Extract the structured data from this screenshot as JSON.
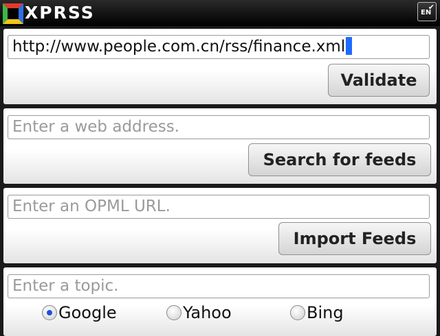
{
  "app": {
    "title": "XPRSS",
    "lang_button": "EN"
  },
  "validate_section": {
    "url_value": "http://www.people.com.cn/rss/finance.xml",
    "button_label": "Validate"
  },
  "search_section": {
    "placeholder": "Enter a web address.",
    "button_label": "Search for feeds"
  },
  "opml_section": {
    "placeholder": "Enter an OPML URL.",
    "button_label": "Import Feeds"
  },
  "topic_section": {
    "placeholder": "Enter a topic.",
    "engines": [
      {
        "label": "Google",
        "selected": true
      },
      {
        "label": "Yahoo",
        "selected": false
      },
      {
        "label": "Bing",
        "selected": false
      }
    ]
  },
  "colors": {
    "accent": "#1e6bff",
    "background": "#1a1a1a"
  },
  "icons": [
    "xprss-logo-icon",
    "check-icon"
  ]
}
